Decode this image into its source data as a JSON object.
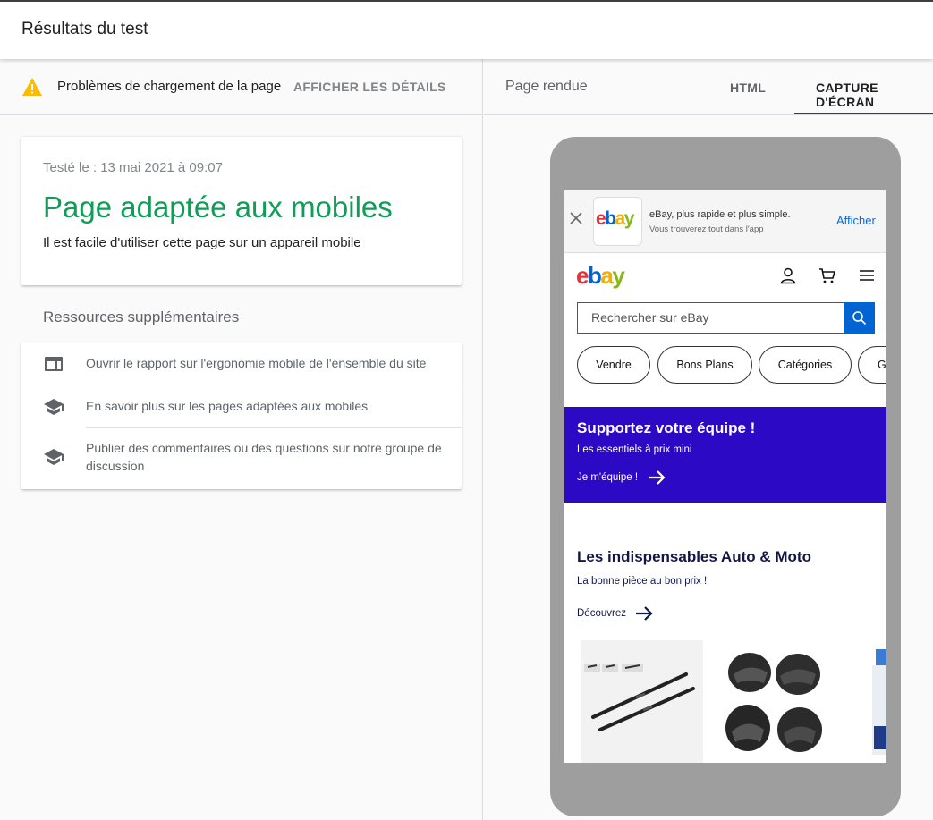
{
  "header": {
    "title": "Résultats du test"
  },
  "warning": {
    "text": "Problèmes de chargement de la page",
    "link": "AFFICHER LES DÉTAILS"
  },
  "result": {
    "tested_on": "Testé le : 13 mai 2021 à 09:07",
    "verdict": "Page adaptée aux mobiles",
    "description": "Il est facile d'utiliser cette page sur un appareil mobile"
  },
  "resources": {
    "title": "Ressources supplémentaires",
    "items": [
      {
        "label": "Ouvrir le rapport sur l'ergonomie mobile de l'ensemble du site",
        "icon": "web-icon"
      },
      {
        "label": "En savoir plus sur les pages adaptées aux mobiles",
        "icon": "school-icon"
      },
      {
        "label": "Publier des commentaires ou des questions sur notre groupe de discussion",
        "icon": "school-icon"
      }
    ]
  },
  "right_panel": {
    "label": "Page rendue",
    "tabs": [
      {
        "label": "HTML",
        "active": false
      },
      {
        "label": "CAPTURE D'ÉCRAN",
        "active": true
      }
    ]
  },
  "screenshot": {
    "banner": {
      "title": "eBay, plus rapide et plus simple.",
      "subtitle": "Vous trouverez tout dans l'app",
      "button": "Afficher"
    },
    "logo": {
      "e": "e",
      "b": "b",
      "a": "a",
      "y": "y"
    },
    "search_placeholder": "Rechercher sur eBay",
    "pills": [
      "Vendre",
      "Bons Plans",
      "Catégories",
      "G"
    ],
    "promo": {
      "title": "Supportez votre équipe !",
      "subtitle": "Les essentiels à prix mini",
      "cta": "Je m'équipe !"
    },
    "auto": {
      "title": "Les indispensables Auto & Moto",
      "subtitle": "La bonne pièce au bon prix !",
      "cta": "Découvrez"
    },
    "colors": {
      "promo_bg": "#2c09c4",
      "accent_blue": "#0064d2",
      "verdict_green": "#0f9d58"
    }
  }
}
